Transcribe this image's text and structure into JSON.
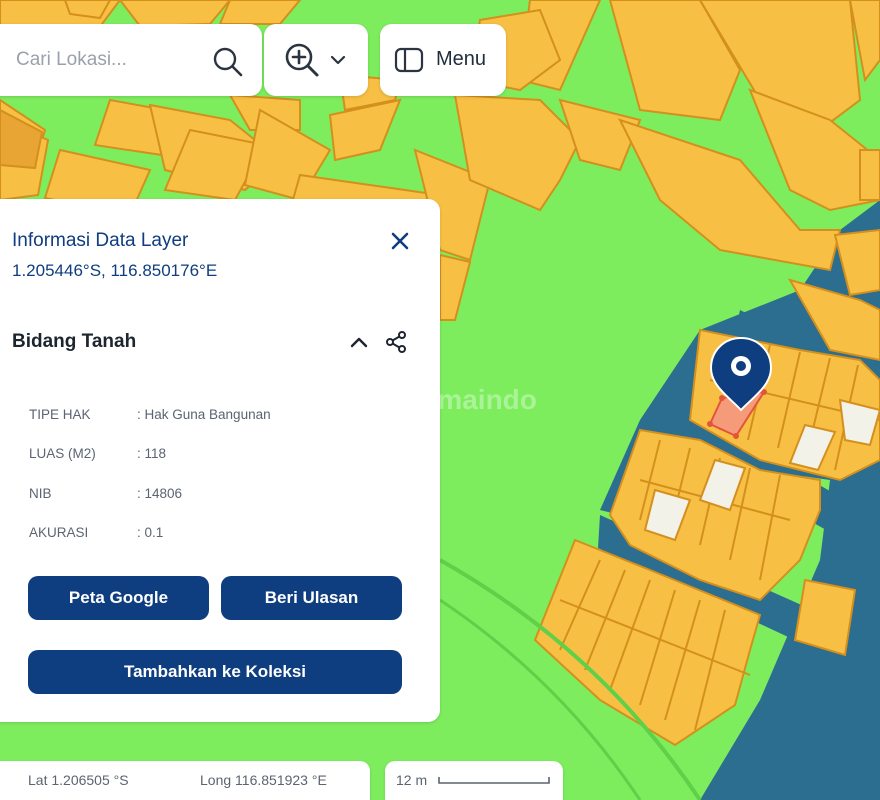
{
  "search": {
    "placeholder": "Cari Lokasi..."
  },
  "toolbar": {
    "menu_label": "Menu"
  },
  "info_panel": {
    "title": "Informasi Data Layer",
    "coordinates": "1.205446°S, 116.850176°E",
    "section_title": "Bidang Tanah",
    "attributes": [
      {
        "key": "TIPE HAK",
        "value": ": Hak Guna Bangunan"
      },
      {
        "key": "LUAS (M2)",
        "value": ": 118"
      },
      {
        "key": "NIB",
        "value": ": 14806"
      },
      {
        "key": "AKURASI",
        "value": ": 0.1"
      }
    ],
    "buttons": {
      "google_map": "Peta Google",
      "review": "Beri Ulasan",
      "add_collection": "Tambahkan ke Koleksi"
    }
  },
  "status_bar": {
    "lat": "Lat 1.206505 °S",
    "lng": "Long 116.851923 °E",
    "scale": "12 m"
  },
  "watermark": "Rumaindo",
  "colors": {
    "green_area": "#7ded5e",
    "parcel": "#f7c044",
    "parcel_border": "#d48f1c",
    "road": "#2c6e90",
    "selected_parcel": "#f59b7a",
    "primary": "#0f3e80"
  },
  "icons": [
    "search-icon",
    "zoom-in-icon",
    "chevron-down-icon",
    "sidebar-icon",
    "close-icon",
    "chevron-up-icon",
    "share-icon",
    "location-pin-icon"
  ]
}
